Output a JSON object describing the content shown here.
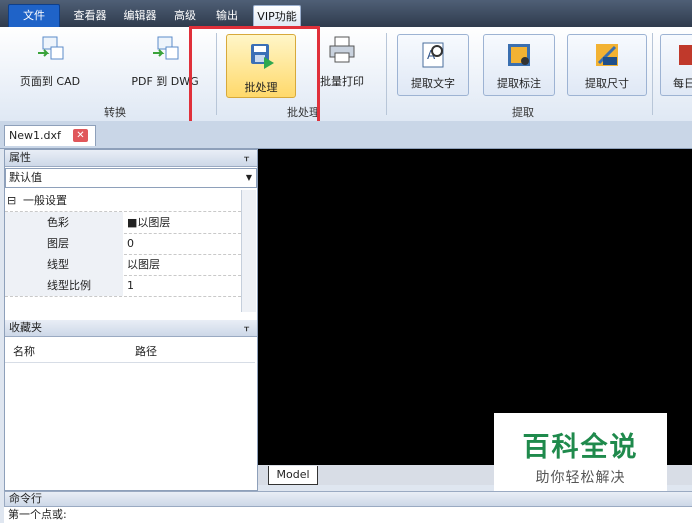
{
  "menu": {
    "tabs": [
      "文件",
      "查看器",
      "编辑器",
      "高级",
      "输出",
      "VIP功能"
    ],
    "active": "VIP功能"
  },
  "ribbon": {
    "convert_group": {
      "label": "转换",
      "buttons": [
        "页面到 CAD",
        "PDF 到 DWG"
      ]
    },
    "batch_group": {
      "label": "批处理",
      "buttons": [
        "批处理",
        "批量打印"
      ]
    },
    "extract_group": {
      "label": "提取",
      "buttons": [
        "提取文字",
        "提取标注",
        "提取尺寸"
      ]
    },
    "partial_button": "每日"
  },
  "doc_tab": {
    "name": "New1.dxf",
    "close": "✕"
  },
  "properties_panel": {
    "title": "属性",
    "pin": "ᚁ",
    "selector_value": "默认值",
    "section": {
      "toggle": "⊟",
      "label": "一般设置"
    },
    "rows": [
      {
        "key": "色彩",
        "value": "■以图层"
      },
      {
        "key": "图层",
        "value": "0"
      },
      {
        "key": "线型",
        "value": "以图层"
      },
      {
        "key": "线型比例",
        "value": "1"
      }
    ]
  },
  "favorites_panel": {
    "title": "收藏夹",
    "pin": "ᚁ",
    "columns": [
      "名称",
      "路径"
    ]
  },
  "canvas": {
    "tab": "Model"
  },
  "watermark": {
    "title": "百科全说",
    "subtitle": "助你轻松解决"
  },
  "command": {
    "title": "命令行",
    "prompt": "第一个点或:"
  },
  "colors": {
    "highlight": "#e0303a",
    "file_tab": "#1f63c8",
    "watermark_green": "#1f8a4c"
  }
}
